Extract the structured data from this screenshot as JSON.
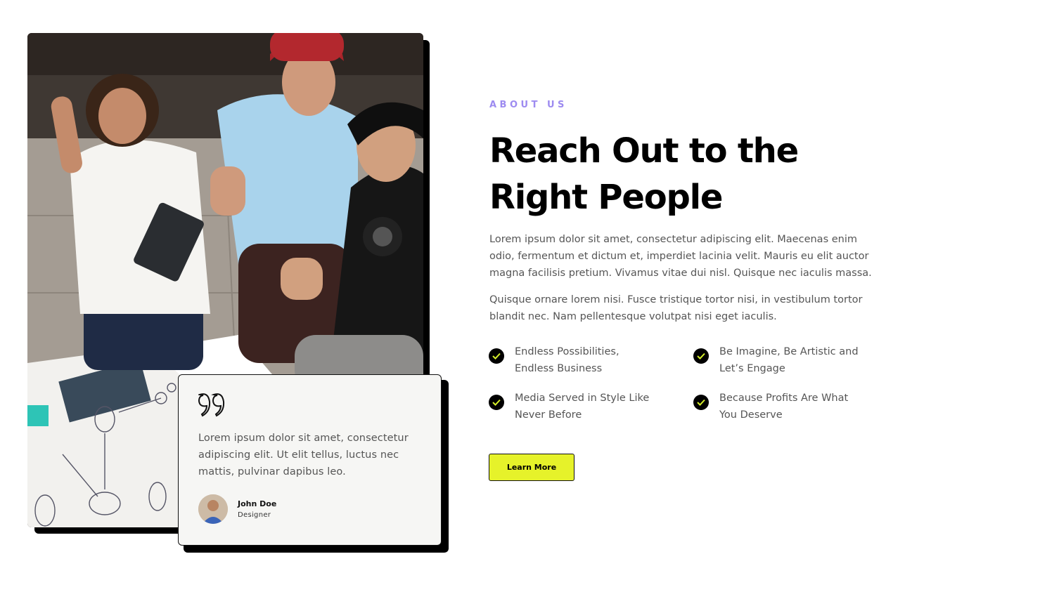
{
  "about": {
    "eyebrow": "ABOUT US",
    "title_line1": "Reach Out to the",
    "title_line2": "Right People",
    "paragraph1": "Lorem ipsum dolor sit amet, consectetur adipiscing elit. Maecenas enim odio, fermentum et dictum et, imperdiet lacinia velit. Mauris eu elit auctor magna facilisis pretium. Vivamus vitae dui nisl. Quisque nec iaculis massa.",
    "paragraph2": "Quisque ornare lorem nisi. Fusce tristique tortor nisi, in vestibulum tortor blandit nec. Nam pellentesque volutpat nisi eget iaculis.",
    "features": [
      {
        "line1": "Endless Possibilities,",
        "line2": "Endless Business"
      },
      {
        "line1": "Be Imagine, Be Artistic and",
        "line2": "Let’s Engage"
      },
      {
        "line1": "Media Served in Style Like",
        "line2": "Never Before"
      },
      {
        "line1": "Because Profits Are What",
        "line2": "You Deserve"
      }
    ],
    "button_label": "Learn More"
  },
  "testimonial": {
    "quote": "Lorem ipsum dolor sit amet, consectetur adipiscing elit. Ut elit tellus, luctus nec mattis, pulvinar dapibus leo.",
    "author_name": "John Doe",
    "author_role": "Designer"
  },
  "icons": {
    "quote": "quote-icon",
    "check": "check-icon"
  },
  "colors": {
    "accent_purple": "#9d8bf0",
    "button_yellow": "#e6f22a",
    "check_mark": "#d6f02a"
  }
}
